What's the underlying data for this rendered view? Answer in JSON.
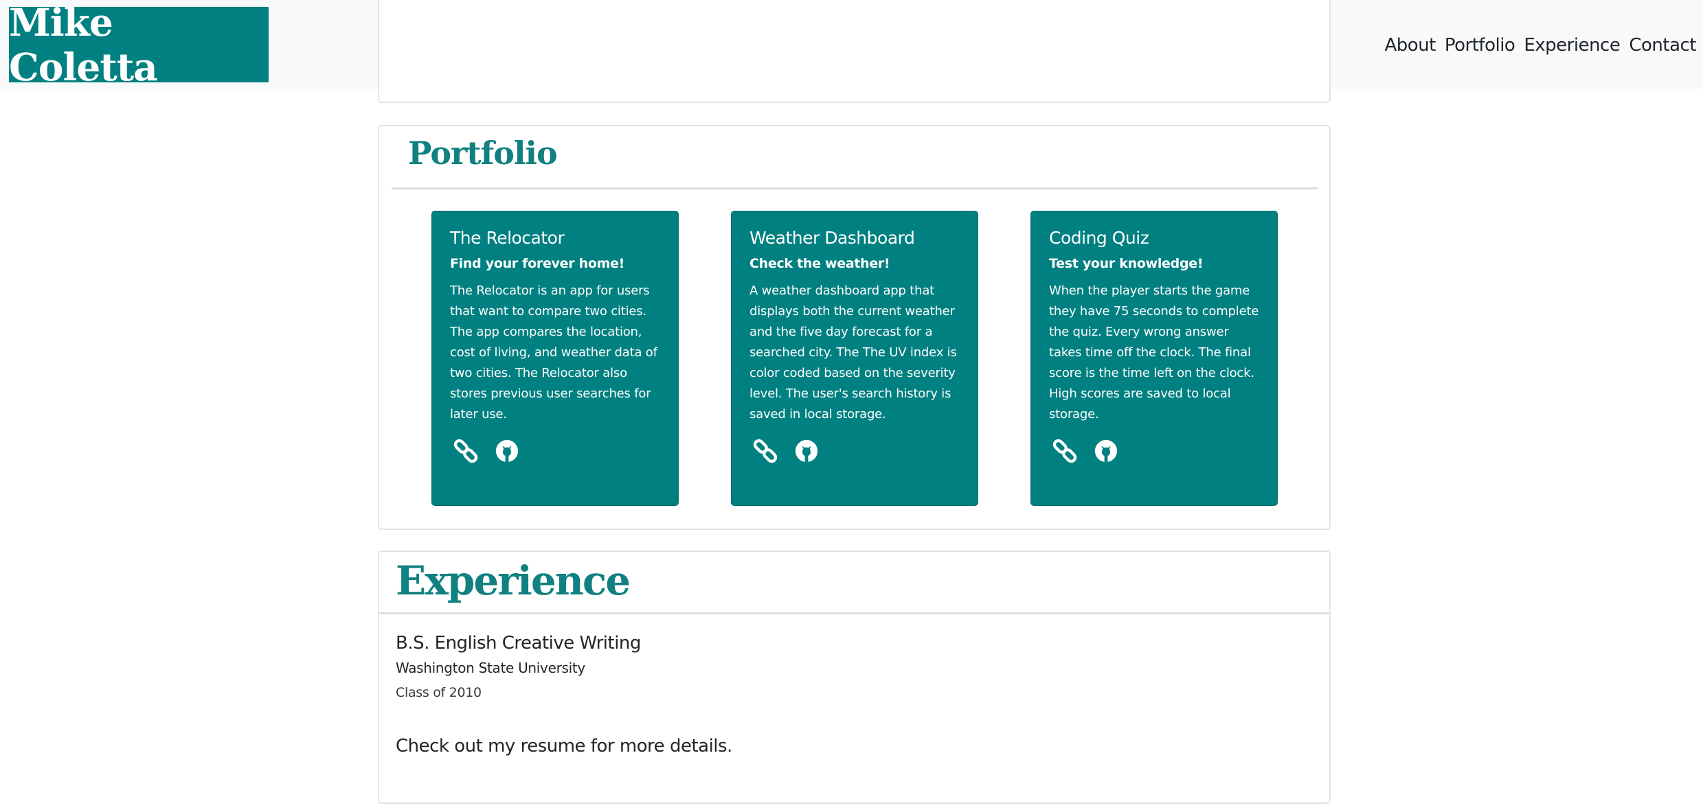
{
  "header": {
    "brand": "Mike Coletta",
    "nav": [
      "About",
      "Portfolio",
      "Experience",
      "Contact"
    ]
  },
  "portfolio": {
    "title": "Portfolio",
    "projects": [
      {
        "title": "The Relocator",
        "subtitle": "Find your forever home!",
        "description": "The Relocator is an app for users that want to compare two cities. The app compares the location, cost of living, and weather data of two cities. The Relocator also stores previous user searches for later use.",
        "icons": [
          "link-icon",
          "github-icon"
        ]
      },
      {
        "title": "Weather Dashboard",
        "subtitle": "Check the weather!",
        "description": "A weather dashboard app that displays both the current weather and the five day forecast for a searched city. The The UV index is color coded based on the severity level. The user's search history is saved in local storage.",
        "icons": [
          "link-icon",
          "github-icon"
        ]
      },
      {
        "title": "Coding Quiz",
        "subtitle": "Test your knowledge!",
        "description": "When the player starts the game they have 75 seconds to complete the quiz. Every wrong answer takes time off the clock. The final score is the time left on the clock. High scores are saved to local storage.",
        "icons": [
          "link-icon",
          "github-icon"
        ]
      }
    ]
  },
  "experience": {
    "title": "Experience",
    "degree": "B.S. English Creative Writing",
    "school": "Washington State University",
    "class_of": "Class of 2010",
    "cta_before": "Check out my ",
    "cta_link": "resume",
    "cta_after": " for more details."
  },
  "colors": {
    "brand": "#008080",
    "heading": "#118080",
    "navbar_bg": "#f8f9fa"
  }
}
